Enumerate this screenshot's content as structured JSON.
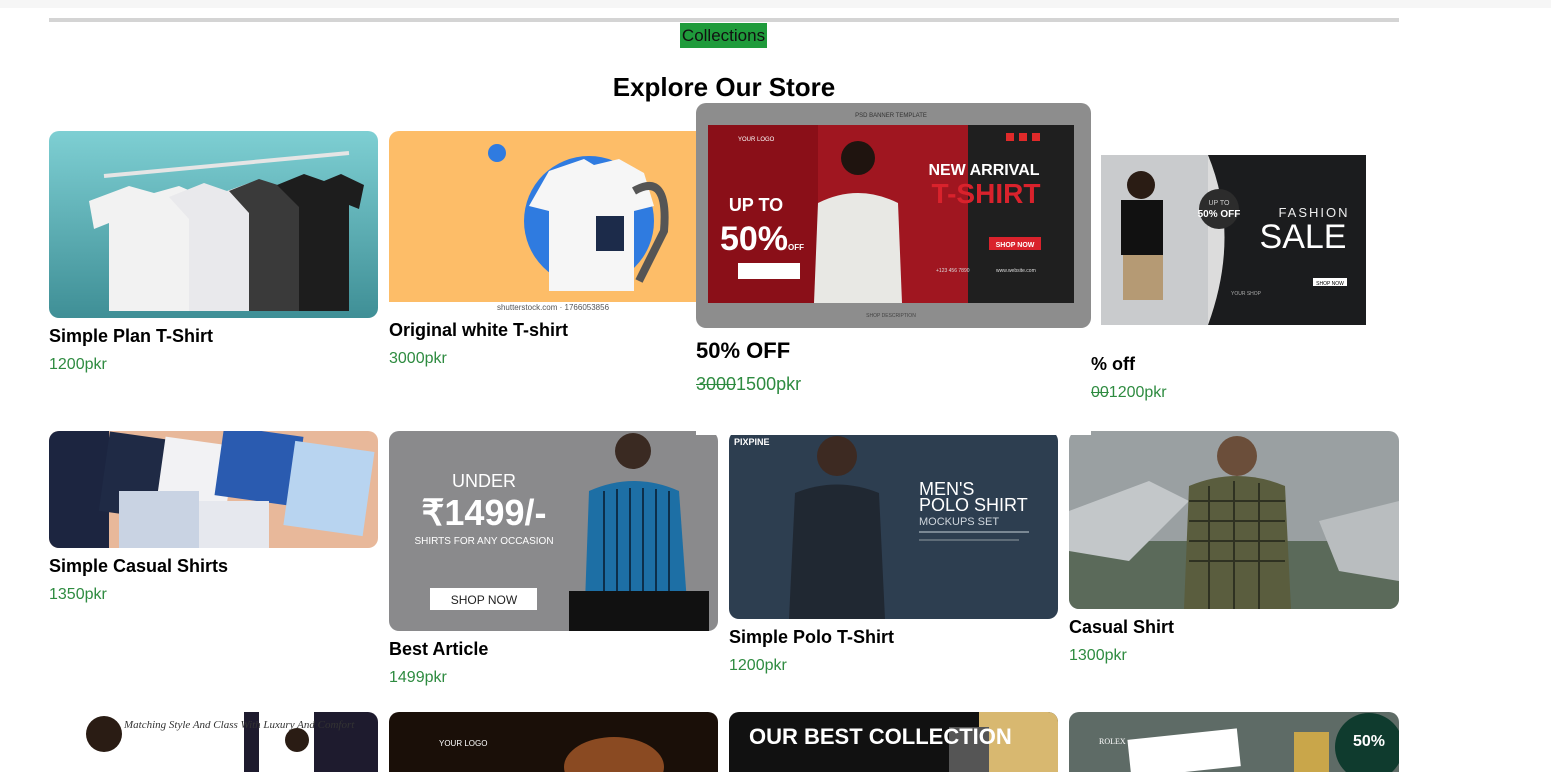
{
  "nav": {
    "collections_label": "Collections"
  },
  "section_title": "Explore Our Store",
  "products": [
    {
      "name": "Simple Plan T-Shirt",
      "price": "1200pkr"
    },
    {
      "name": "Original white T-shirt",
      "price": "3000pkr",
      "watermark": "shutterstock.com · 1766053856"
    },
    {
      "name": "50% OFF",
      "old_price": "3000",
      "price": "1500pkr",
      "banner": {
        "logo": "YOUR LOGO",
        "pre": "PSD BANNER TEMPLATE",
        "line1": "NEW ARRIVAL",
        "line2": "T-SHIRT",
        "up_to": "UP TO",
        "pct": "50%",
        "off": "OFF",
        "cta": "SHOP NOW",
        "phone": "+123 456 7890",
        "web": "www.website.com",
        "foot": "SHOP DESCRIPTION"
      }
    },
    {
      "name": "% off",
      "old_price": "00",
      "price": "1200pkr",
      "banner": {
        "title": "FASHION",
        "sale": "SALE",
        "badge": "50% OFF",
        "badge_pre": "UP TO",
        "cta": "SHOP NOW",
        "brand": "YOUR SHOP"
      }
    },
    {
      "name": "Simple Casual Shirts",
      "price": "1350pkr"
    },
    {
      "name": "Best Article",
      "price": "1499pkr",
      "banner": {
        "under": "UNDER",
        "amount": "₹1499/-",
        "sub": "SHIRTS FOR ANY OCCASION",
        "cta": "SHOP NOW"
      }
    },
    {
      "name": "Simple Polo T-Shirt",
      "price": "1200pkr",
      "banner": {
        "brand": "PIXPINE",
        "l1": "MEN'S",
        "l2": "POLO SHIRT",
        "l3": "MOCKUPS SET"
      }
    },
    {
      "name": "Casual Shirt",
      "price": "1300pkr"
    }
  ],
  "bottom_row": [
    {
      "banner": "Matching Style And Class With Luxury And Comfort"
    },
    {
      "banner": "YOUR LOGO"
    },
    {
      "banner": "OUR BEST COLLECTION"
    },
    {
      "banner": "ROLEX",
      "pct": "50%"
    }
  ],
  "colors": {
    "accent": "#1f9b3b",
    "price": "#2e8b40"
  }
}
